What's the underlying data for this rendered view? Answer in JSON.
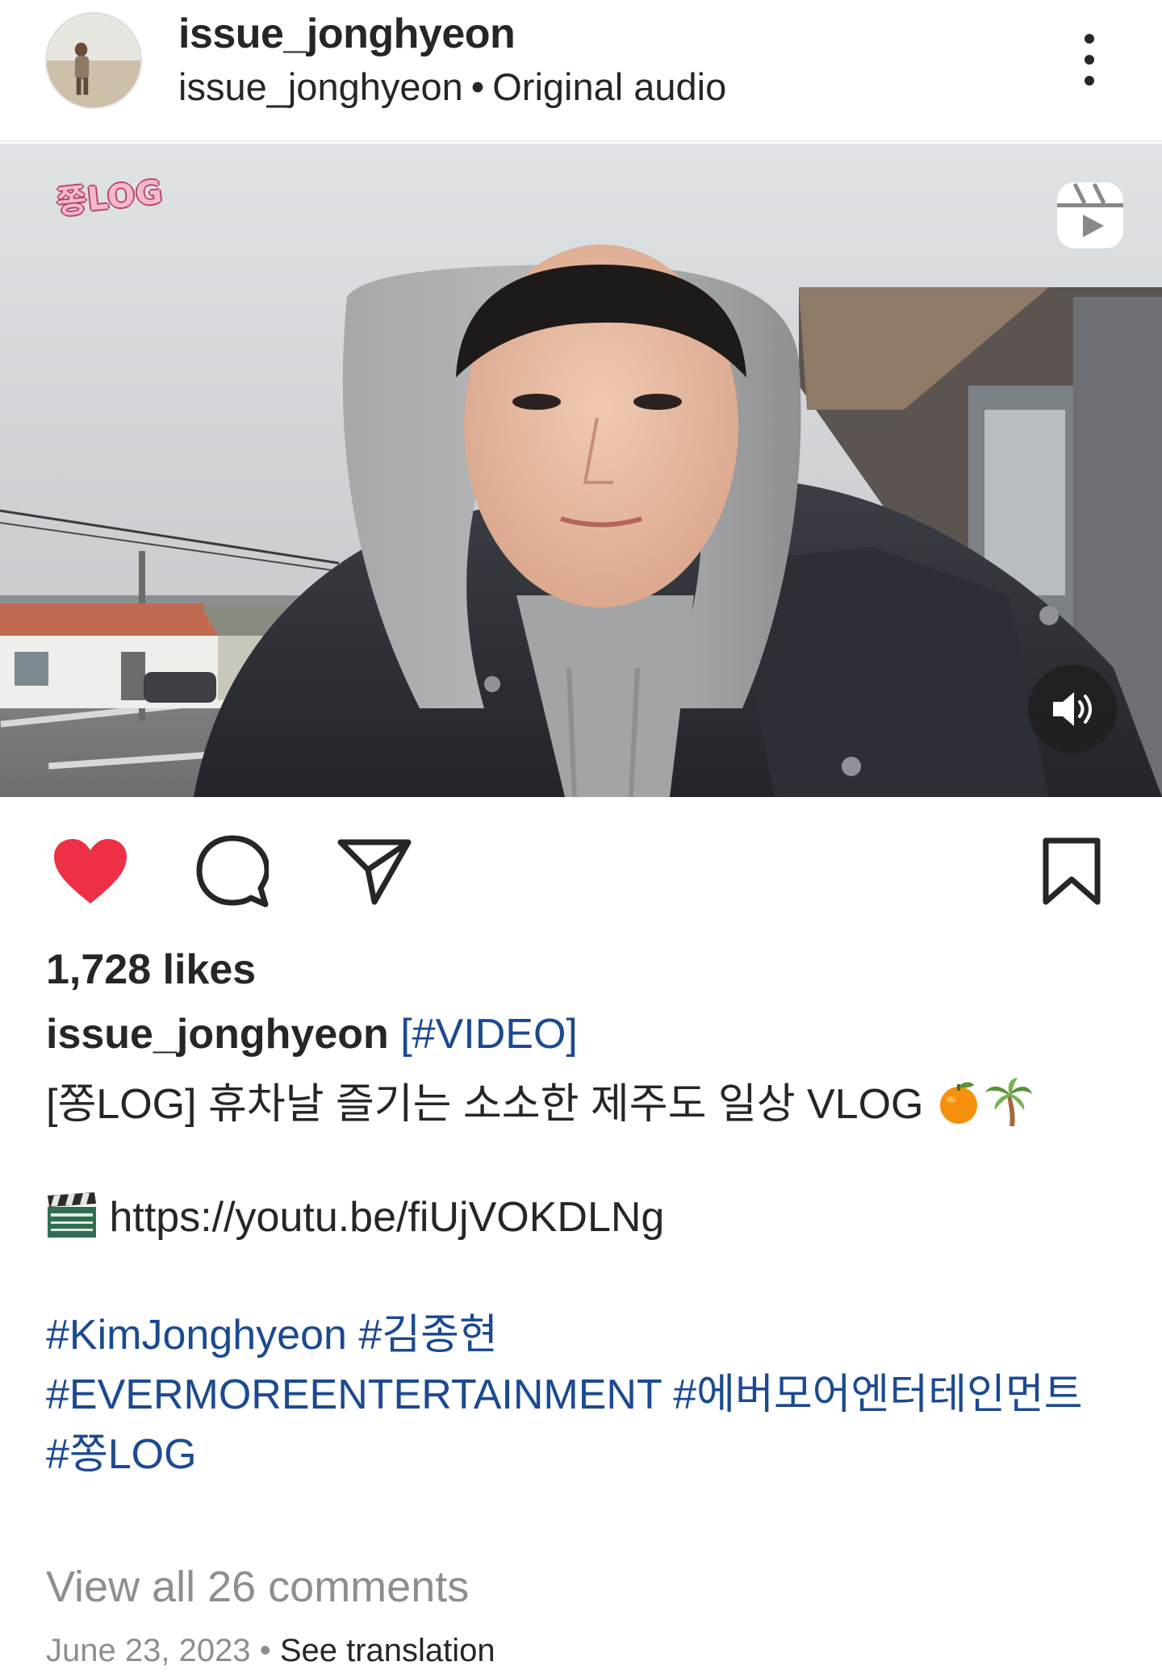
{
  "header": {
    "username": "issue_jonghyeon",
    "audio_owner": "issue_jonghyeon",
    "separator": "•",
    "audio_label": "Original audio"
  },
  "media": {
    "overlay_logo": "쫑LOG"
  },
  "post": {
    "likes": "1,728 likes",
    "caption_user": "issue_jonghyeon",
    "caption_tag": "[#VIDEO]",
    "title_line": "[쫑LOG] 휴차날 즐기는 소소한 제주도 일상 VLOG",
    "link": "https://youtu.be/fiUjVOKDLNg",
    "hashtags_line1": "#KimJonghyeon #김종현",
    "hashtags_line2": "#EVERMOREENTERTAINMENT #에버모어엔터테인먼트",
    "hashtags_line3": "#쫑LOG",
    "view_comments": "View all 26 comments",
    "date": "June 23, 2023",
    "meta_separator": "•",
    "see_translation": "See translation"
  },
  "icons": {
    "like": "heart-filled-icon",
    "comment": "comment-bubble-icon",
    "share": "paper-plane-icon",
    "save": "bookmark-icon",
    "reel": "reels-icon",
    "sound": "speaker-icon",
    "more": "more-vertical-icon"
  },
  "colors": {
    "like": "#ed3046",
    "link_blue": "#1c4a91",
    "muted": "#8e8e8e",
    "text": "#262626"
  }
}
